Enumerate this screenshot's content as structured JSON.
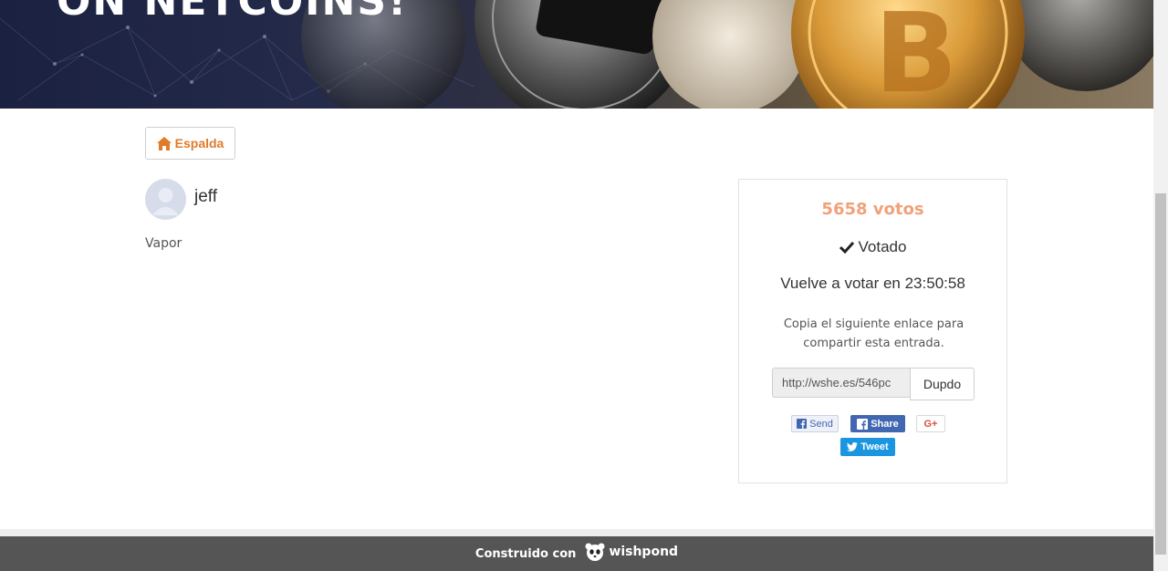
{
  "hero": {
    "title": "ON NETCOINS!"
  },
  "nav": {
    "back_label": "Espalda"
  },
  "entry": {
    "author": "jeff",
    "text": "Vapor"
  },
  "vote_card": {
    "votes": "5658 votos",
    "status": "Votado",
    "revote": "Vuelve a votar en 23:50:58",
    "share_hint": "Copia el siguiente enlace para compartir esta entrada.",
    "link_value": "http://wshe.es/546pc",
    "copy_label": "Dupdo",
    "social": {
      "send": "Send",
      "share": "Share",
      "gplus": "G+",
      "tweet": "Tweet"
    }
  },
  "footer": {
    "built_with": "Construido con",
    "brand": "wishpond"
  },
  "colors": {
    "accent": "#e07b2a",
    "votes": "#f0a27a",
    "facebook": "#4267b2",
    "twitter": "#1b95e0",
    "google": "#dd4b39",
    "footer": "#555555"
  }
}
